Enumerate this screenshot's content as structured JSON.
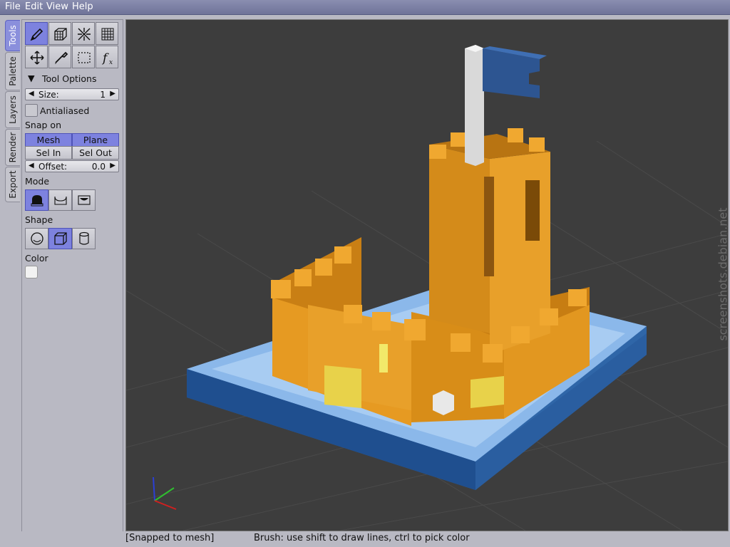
{
  "menu": [
    "File",
    "Edit",
    "View",
    "Help"
  ],
  "tabs": [
    {
      "label": "Tools",
      "active": true
    },
    {
      "label": "Palette",
      "active": false
    },
    {
      "label": "Layers",
      "active": false
    },
    {
      "label": "Render",
      "active": false
    },
    {
      "label": "Export",
      "active": false
    }
  ],
  "tools": {
    "row1": [
      "pencil-icon",
      "cube-icon",
      "sparkle-icon",
      "grid-icon"
    ],
    "row2": [
      "move-icon",
      "eyedropper-icon",
      "selection-rect-icon",
      "function-icon"
    ],
    "active": "pencil-icon"
  },
  "tool_options": {
    "header": "Tool Options",
    "size_label": "Size:",
    "size_value": "1",
    "antialiased_label": "Antialiased",
    "antialiased": false,
    "snap_on_label": "Snap on",
    "snap_buttons": [
      {
        "label": "Mesh",
        "active": true
      },
      {
        "label": "Plane",
        "active": true
      },
      {
        "label": "Sel In",
        "active": false
      },
      {
        "label": "Sel Out",
        "active": false
      }
    ],
    "offset_label": "Offset:",
    "offset_value": "0.0",
    "mode_label": "Mode",
    "mode_active": 0,
    "shape_label": "Shape",
    "shape_active": 1,
    "color_label": "Color",
    "color_value": "#f2f2f2"
  },
  "status": {
    "left": "[Snapped to mesh]",
    "right": "Brush: use shift to draw lines, ctrl to pick color"
  },
  "watermark": "screenshots.debian.net",
  "colors": {
    "accent": "#7d82df",
    "menubar": "#7276a0",
    "viewport_bg": "#3d3d3d",
    "castle": "#e0951c",
    "water_light": "#8bb8ea",
    "water_dark": "#2f66a8",
    "flag": "#2d5591"
  }
}
